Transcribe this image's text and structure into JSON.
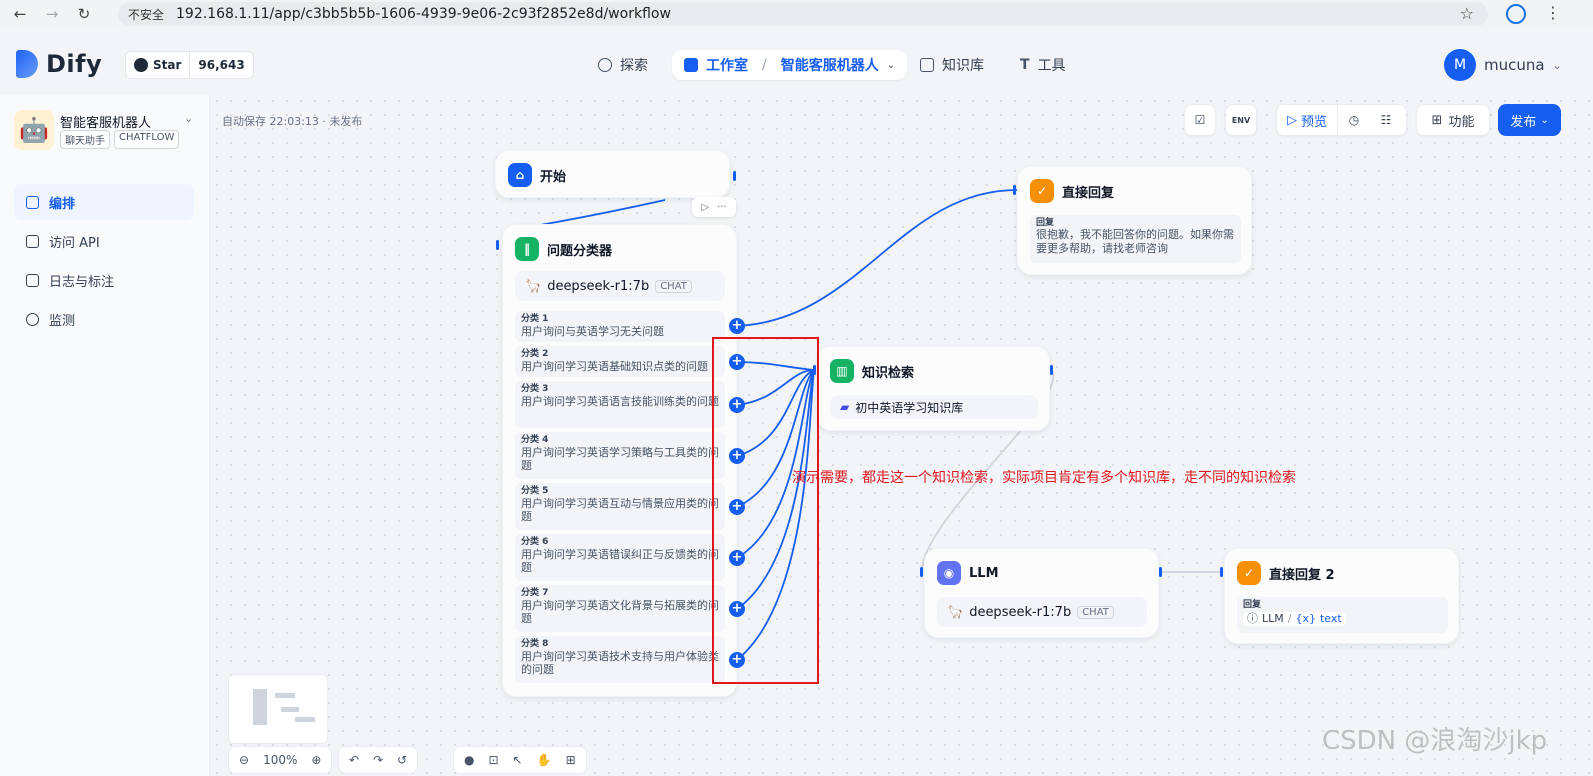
{
  "browser": {
    "security_label": "不安全",
    "url": "192.168.1.11/app/c3bb5b5b-1606-4939-9e06-2c93f2852e8d/workflow"
  },
  "header": {
    "logo": "Dify",
    "github_star": "Star",
    "github_count": "96,643",
    "nav_explore": "探索",
    "nav_studio": "工作室",
    "nav_app": "智能客服机器人",
    "nav_kb": "知识库",
    "nav_tools": "工具",
    "user_initial": "M",
    "user_name": "mucuna"
  },
  "sidebar": {
    "app_name": "智能客服机器人",
    "tag1": "聊天助手",
    "tag2": "CHATFLOW",
    "items": [
      {
        "label": "编排"
      },
      {
        "label": "访问 API"
      },
      {
        "label": "日志与标注"
      },
      {
        "label": "监测"
      }
    ]
  },
  "canvas": {
    "autosave": "自动保存 22:03:13 · 未发布",
    "preview": "预览",
    "features": "功能",
    "publish": "发布",
    "env": "ENV"
  },
  "nodes": {
    "start": {
      "title": "开始"
    },
    "classifier": {
      "title": "问题分类器",
      "model": "deepseek-r1:7b",
      "model_tag": "CHAT",
      "classes": [
        {
          "title": "分类 1",
          "desc": "用户询问与英语学习无关问题"
        },
        {
          "title": "分类 2",
          "desc": "用户询问学习英语基础知识点类的问题"
        },
        {
          "title": "分类 3",
          "desc": "用户询问学习英语语言技能训练类的问题"
        },
        {
          "title": "分类 4",
          "desc": "用户询问学习英语学习策略与工具类的问题"
        },
        {
          "title": "分类 5",
          "desc": "用户询问学习英语互动与情景应用类的问题"
        },
        {
          "title": "分类 6",
          "desc": "用户询问学习英语错误纠正与反馈类的问题"
        },
        {
          "title": "分类 7",
          "desc": "用户询问学习英语文化背景与拓展类的问题"
        },
        {
          "title": "分类 8",
          "desc": "用户询问学习英语技术支持与用户体验类的问题"
        }
      ]
    },
    "reply1": {
      "title": "直接回复",
      "label": "回复",
      "text": "很抱歉，我不能回答你的问题。如果你需要更多帮助，请找老师咨询"
    },
    "knowledge": {
      "title": "知识检索",
      "dataset": "初中英语学习知识库"
    },
    "llm": {
      "title": "LLM",
      "model": "deepseek-r1:7b",
      "model_tag": "CHAT"
    },
    "reply2": {
      "title": "直接回复 2",
      "label": "回复",
      "var_node": "LLM",
      "var_name": "text"
    }
  },
  "annotation": "演示需要，都走这一个知识检索，实际项目肯定有多个知识库，走不同的知识检索",
  "controls": {
    "zoom": "100%"
  },
  "watermark": "CSDN @浪淘沙jkp",
  "colors": {
    "accent": "#155eef",
    "annotation": "#e1171e",
    "orange_node": "#f79009",
    "green_node": "#16b364",
    "purple_node": "#6172f3"
  }
}
